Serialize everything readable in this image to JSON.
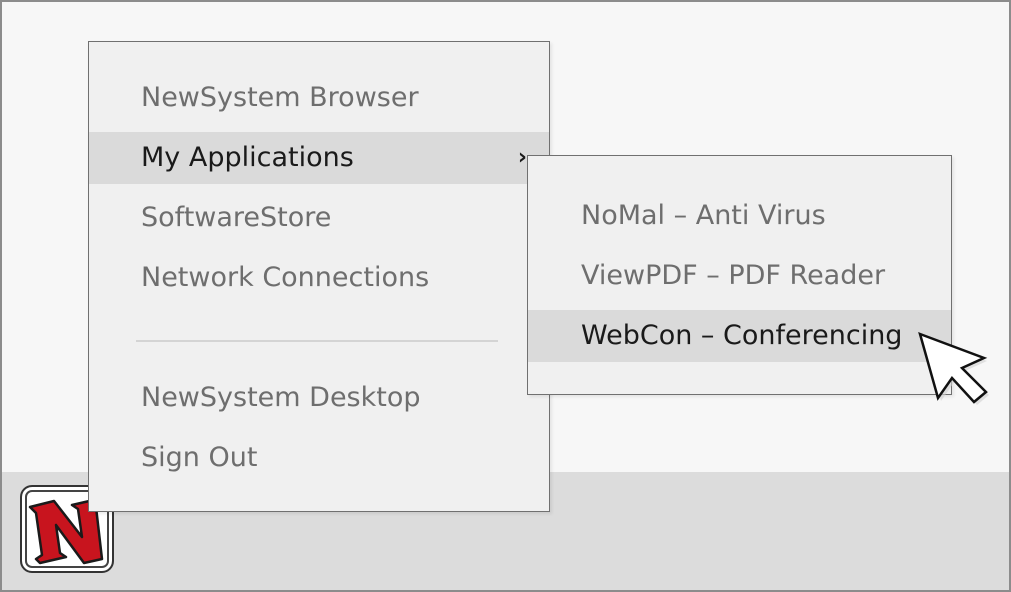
{
  "main_menu": {
    "items": [
      {
        "label": "NewSystem Browser"
      },
      {
        "label": "My Applications",
        "submenu_indicator": "›"
      },
      {
        "label": "SoftwareStore"
      },
      {
        "label": "Network Connections"
      },
      {
        "label": "NewSystem Desktop"
      },
      {
        "label": "Sign Out"
      }
    ],
    "active_item": "My Applications"
  },
  "sub_menu": {
    "items": [
      {
        "label": "NoMal – Anti Virus"
      },
      {
        "label": "ViewPDF – PDF Reader"
      },
      {
        "label": "WebCon – Conferencing"
      }
    ],
    "active_item": "WebCon – Conferencing"
  },
  "start_button": {
    "logo_letter": "N",
    "icon": "newsystem-logo-icon",
    "logo_color": "#c8141e"
  },
  "cursor": {
    "icon": "arrow-pointer-icon"
  },
  "colors": {
    "taskbar": "#dcdcdc",
    "desktop": "#f7f7f7",
    "menu_background": "#f0f0f0",
    "highlight": "#dadada",
    "inactive_text": "#6e6e6e",
    "active_text": "#1a1a1a"
  }
}
